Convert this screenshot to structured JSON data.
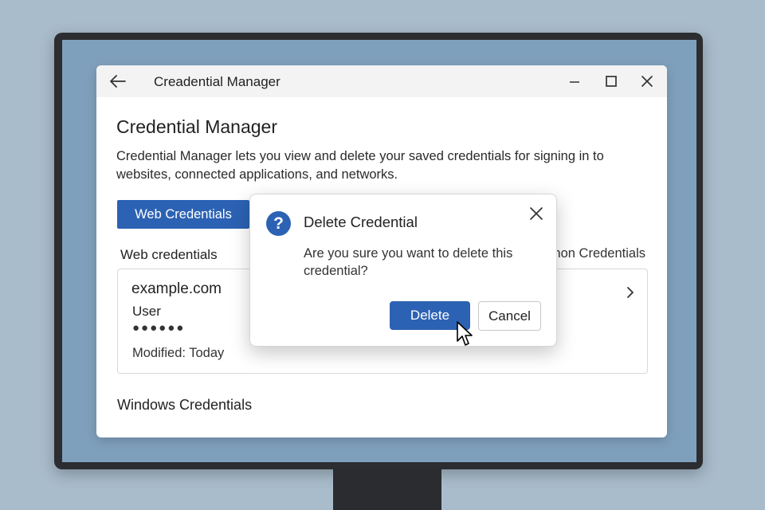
{
  "window": {
    "title": "Creadential Manager"
  },
  "main": {
    "heading": "Credential Manager",
    "description": "Credential Manager lets you view and delete your saved credentials for signing in to websites, connected applications, and networks.",
    "tab_web": "Web Credentials",
    "section_web": "Web credentials",
    "section_windows_partial": "non Credentials",
    "credential": {
      "site": "example.com",
      "user": "User",
      "password_mask": "●●●●●●",
      "modified": "Modified:  Today"
    },
    "section_windows": "Windows Credentials"
  },
  "dialog": {
    "icon_glyph": "?",
    "title": "Delete Credential",
    "message": "Are you sure you want to delete this credential?",
    "delete_label": "Delete",
    "cancel_label": "Cancel"
  },
  "colors": {
    "accent": "#2c62b4",
    "desktop": "#a9bccb",
    "screen": "#7fa0bd"
  },
  "icons": {
    "back": "back-arrow-icon",
    "minimize": "minimize-icon",
    "maximize": "maximize-icon",
    "close": "close-icon",
    "chevron": "chevron-right-icon",
    "question": "question-icon",
    "cursor": "mouse-pointer-icon"
  }
}
